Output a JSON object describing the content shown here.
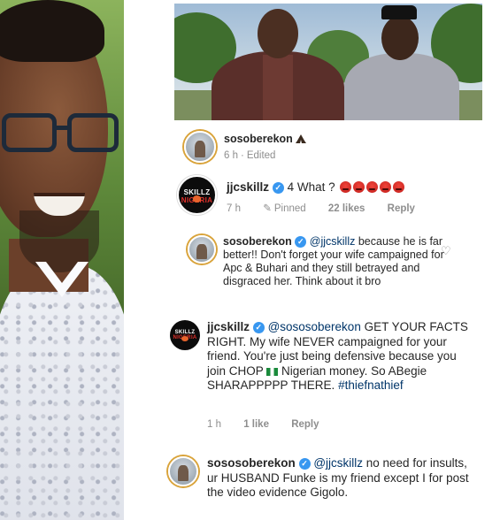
{
  "comments": [
    {
      "username": "sosoberekon",
      "text": "",
      "time": "6 h",
      "status": "Edited"
    },
    {
      "username": "jjcskillz",
      "verified": true,
      "text": "4 What ?",
      "time": "7 h",
      "pinned_label": "Pinned",
      "likes": "22 likes",
      "reply": "Reply",
      "avatar_text_a": "SKILLZ ",
      "avatar_text_b": "NIGERIA"
    },
    {
      "username": "sosoberekon",
      "verified": true,
      "mention": "@jjcskillz",
      "text": " because he is far better!! Don't forget your wife campaigned for Apc & Buhari and they still betrayed and disgraced her. Think about it bro"
    },
    {
      "username": "jjcskillz",
      "verified": true,
      "mention": "@sososoberekon",
      "text_a": " GET YOUR FACTS RIGHT. My wife NEVER campaigned for your friend. You're just being defensive because you join CHOP ",
      "text_b": " Nigerian money. So ABegie SHARAPPPPP THERE. ",
      "hashtag": "#thiefnathief",
      "time": "1 h",
      "likes": "1 like",
      "reply": "Reply"
    },
    {
      "username": "sososoberekon",
      "verified": true,
      "mention": "@jjcskillz",
      "text": " no need for insults, ur HUSBAND Funke is my friend except I for post the video evidence Gigolo."
    }
  ],
  "icons": [
    "pray-emoji",
    "verified-badge-icon",
    "angry-emoji",
    "pin-icon",
    "heart-icon",
    "nigeria-flag-emoji"
  ],
  "colors": {
    "verified": "#3897f0",
    "mention": "#003569",
    "meta": "#8e8e8e"
  }
}
